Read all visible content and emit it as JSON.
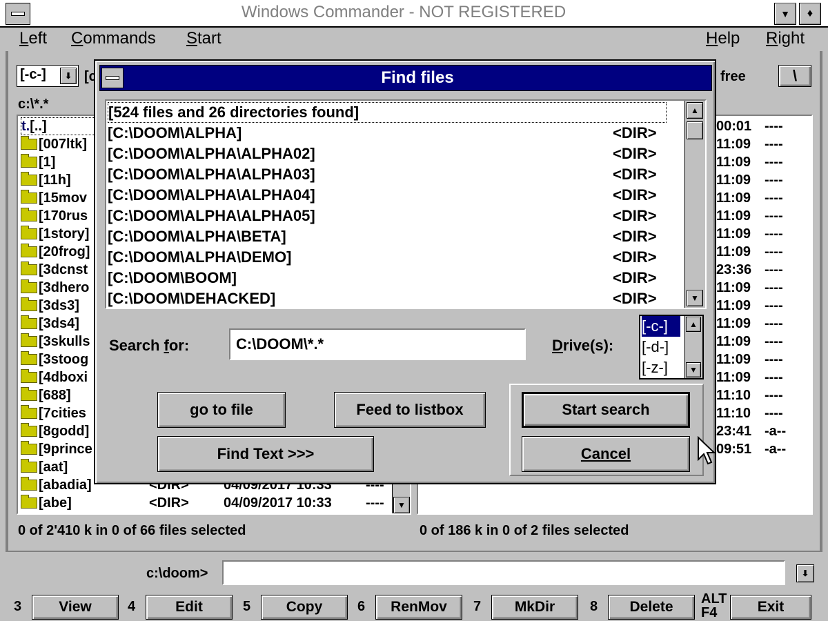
{
  "window": {
    "title": "Windows Commander - NOT REGISTERED",
    "sysmenu": "-",
    "minimize": "▼",
    "maximize": "♦"
  },
  "menu": {
    "left": "Left",
    "commands": "Commands",
    "start": "Start",
    "help": "Help",
    "right": "Right"
  },
  "left_panel": {
    "drive": "[-c-]",
    "drive_label_fragment": "[c",
    "path": "c:\\*.*",
    "status": "0 of 2'410 k in 0 of 66 files selected",
    "up_entry": "[..]",
    "items": [
      {
        "name": "[007ltk]"
      },
      {
        "name": "[1]"
      },
      {
        "name": "[11h]"
      },
      {
        "name": "[15mov"
      },
      {
        "name": "[170rus"
      },
      {
        "name": "[1story]"
      },
      {
        "name": "[20frog]"
      },
      {
        "name": "[3dcnst"
      },
      {
        "name": "[3dhero"
      },
      {
        "name": "[3ds3]"
      },
      {
        "name": "[3ds4]"
      },
      {
        "name": "[3skulls"
      },
      {
        "name": "[3stoog"
      },
      {
        "name": "[4dboxi"
      },
      {
        "name": "[688]"
      },
      {
        "name": "[7cities"
      },
      {
        "name": "[8godd]"
      },
      {
        "name": "[9prince"
      },
      {
        "name": "[aat]"
      },
      {
        "name": "[abadia]",
        "size": "<DIR>",
        "date": "04/09/2017 10:33",
        "attr": "----"
      },
      {
        "name": "[abe]",
        "size": "<DIR>",
        "date": "04/09/2017 10:33",
        "attr": "----"
      }
    ]
  },
  "right_panel": {
    "free_label": "free",
    "root_button": "\\",
    "status": "0 of 186 k in 0 of 2 files selected",
    "items": [
      {
        "time": "00:01",
        "attr": "----"
      },
      {
        "time": "11:09",
        "attr": "----"
      },
      {
        "time": "11:09",
        "attr": "----"
      },
      {
        "time": "11:09",
        "attr": "----"
      },
      {
        "time": "11:09",
        "attr": "----"
      },
      {
        "time": "11:09",
        "attr": "----"
      },
      {
        "time": "11:09",
        "attr": "----"
      },
      {
        "time": "11:09",
        "attr": "----"
      },
      {
        "time": "23:36",
        "attr": "----"
      },
      {
        "time": "11:09",
        "attr": "----"
      },
      {
        "time": "11:09",
        "attr": "----"
      },
      {
        "time": "11:09",
        "attr": "----"
      },
      {
        "time": "11:09",
        "attr": "----"
      },
      {
        "time": "11:09",
        "attr": "----"
      },
      {
        "time": "11:09",
        "attr": "----"
      },
      {
        "time": "11:10",
        "attr": "----"
      },
      {
        "time": "11:10",
        "attr": "----"
      },
      {
        "time": "23:41",
        "attr": "-a--"
      },
      {
        "time": "09:51",
        "attr": "-a--"
      }
    ]
  },
  "dialog": {
    "title": "Find files",
    "results": [
      {
        "name": "[524 files and 26 directories found]",
        "tag": ""
      },
      {
        "name": "[C:\\DOOM\\ALPHA]",
        "tag": "<DIR>"
      },
      {
        "name": "[C:\\DOOM\\ALPHA\\ALPHA02]",
        "tag": "<DIR>"
      },
      {
        "name": "[C:\\DOOM\\ALPHA\\ALPHA03]",
        "tag": "<DIR>"
      },
      {
        "name": "[C:\\DOOM\\ALPHA\\ALPHA04]",
        "tag": "<DIR>"
      },
      {
        "name": "[C:\\DOOM\\ALPHA\\ALPHA05]",
        "tag": "<DIR>"
      },
      {
        "name": "[C:\\DOOM\\ALPHA\\BETA]",
        "tag": "<DIR>"
      },
      {
        "name": "[C:\\DOOM\\ALPHA\\DEMO]",
        "tag": "<DIR>"
      },
      {
        "name": "[C:\\DOOM\\BOOM]",
        "tag": "<DIR>"
      },
      {
        "name": "[C:\\DOOM\\DEHACKED]",
        "tag": "<DIR>"
      }
    ],
    "search_for_label": "Search for:",
    "search_value": "C:\\DOOM\\*.*",
    "drives_label": "Drive(s):",
    "drives": [
      "[-c-]",
      "[-d-]",
      "[-z-]"
    ],
    "buttons": {
      "go_to_file": "go to file",
      "feed": "Feed to listbox",
      "start": "Start search",
      "find_text": "Find Text >>>",
      "cancel": "Cancel"
    }
  },
  "command_line": {
    "prompt": "c:\\doom>",
    "value": ""
  },
  "function_keys": [
    {
      "num": "3",
      "label": "View"
    },
    {
      "num": "4",
      "label": "Edit"
    },
    {
      "num": "5",
      "label": "Copy"
    },
    {
      "num": "6",
      "label": "RenMov"
    },
    {
      "num": "7",
      "label": "MkDir"
    },
    {
      "num": "8",
      "label": "Delete"
    },
    {
      "num": "ALT F4",
      "label": "Exit"
    }
  ],
  "colors": {
    "titlebar_inactive": "#ffffff",
    "dialog_title": "#000080",
    "selection": "#000080",
    "folder": "#c8c800"
  }
}
